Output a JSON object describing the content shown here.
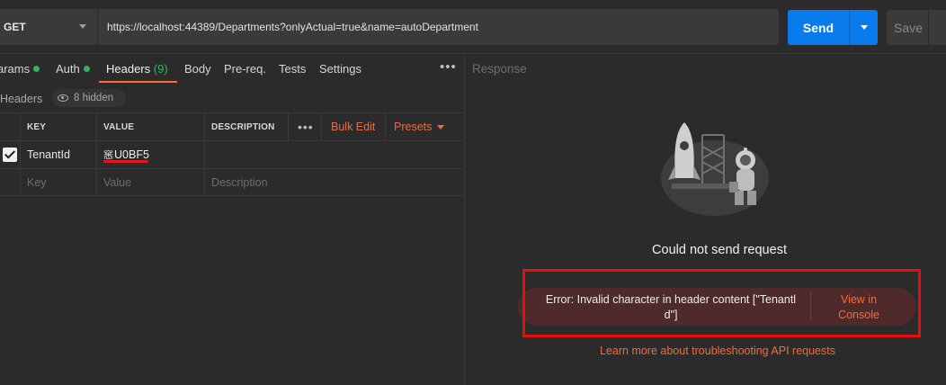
{
  "request": {
    "method": "GET",
    "url": "https://localhost:44389/Departments?onlyActual=true&name=autoDepartment",
    "send_label": "Send",
    "save_label": "Save"
  },
  "tabs": [
    {
      "label": "arams",
      "dot": true
    },
    {
      "label": "Auth",
      "dot": true
    },
    {
      "label": "Headers",
      "count": "(9)",
      "active": true
    },
    {
      "label": "Body"
    },
    {
      "label": "Pre-req."
    },
    {
      "label": "Tests"
    },
    {
      "label": "Settings"
    }
  ],
  "headers_bar": {
    "title": "Headers",
    "hidden_label": "8 hidden"
  },
  "table": {
    "columns": [
      "KEY",
      "VALUE",
      "DESCRIPTION"
    ],
    "bulk_edit": "Bulk Edit",
    "presets": "Presets",
    "rows": [
      {
        "checked": true,
        "key": "TenantId",
        "value_glyph": "窸",
        "value": "U0BF5",
        "description": ""
      }
    ],
    "placeholder": {
      "key": "Key",
      "value": "Value",
      "description": "Description"
    }
  },
  "response": {
    "title": "Response",
    "status": "Could not send request",
    "error_line1": "Error: Invalid character in header content [\"Tenantl",
    "error_line2": "d\"]",
    "view_console_line1": "View in",
    "view_console_line2": "Console",
    "learn_more": "Learn more about troubleshooting API requests"
  },
  "colors": {
    "accent": "#ff6c37",
    "send_blue": "#097bed",
    "status_green": "#2fb35c",
    "error_bg": "#4e2a2a",
    "highlight_red": "#e60d0d"
  }
}
